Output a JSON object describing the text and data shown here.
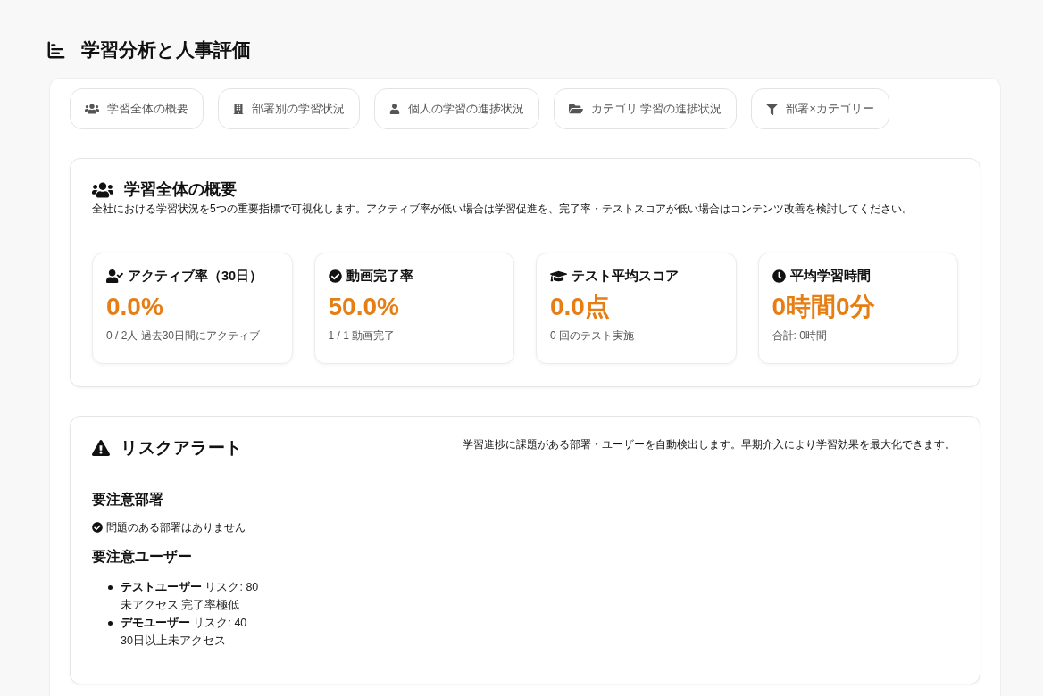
{
  "page_title": "学習分析と人事評価",
  "tabs": [
    {
      "label": "学習全体の概要"
    },
    {
      "label": "部署別の学習状況"
    },
    {
      "label": "個人の学習の進捗状況"
    },
    {
      "label": "カテゴリ 学習の進捗状況"
    },
    {
      "label": "部署×カテゴリー"
    }
  ],
  "overview": {
    "title": "学習全体の概要",
    "description": "全社における学習状況を5つの重要指標で可視化します。アクティブ率が低い場合は学習促進を、完了率・テストスコアが低い場合はコンテンツ改善を検討してください。",
    "metrics": [
      {
        "label": "アクティブ率（30日）",
        "value": "0.0%",
        "note": "0 / 2人 過去30日間にアクティブ"
      },
      {
        "label": "動画完了率",
        "value": "50.0%",
        "note": "1 / 1 動画完了"
      },
      {
        "label": "テスト平均スコア",
        "value": "0.0点",
        "note": "0 回のテスト実施"
      },
      {
        "label": "平均学習時間",
        "value": "0時間0分",
        "note": "合計: 0時間"
      }
    ]
  },
  "risk_alert": {
    "title": "リスクアラート",
    "description": "学習進捗に課題がある部署・ユーザーを自動検出します。早期介入により学習効果を最大化できます。",
    "departments": {
      "heading": "要注意部署",
      "message": "問題のある部署はありません"
    },
    "users": {
      "heading": "要注意ユーザー",
      "items": [
        {
          "summary": "**テストユーザー** リスク: 80",
          "reasons": "未アクセス 完了率極低"
        },
        {
          "summary": "**デモユーザー** リスク: 40",
          "reasons": "30日以上未アクセス"
        }
      ]
    }
  }
}
